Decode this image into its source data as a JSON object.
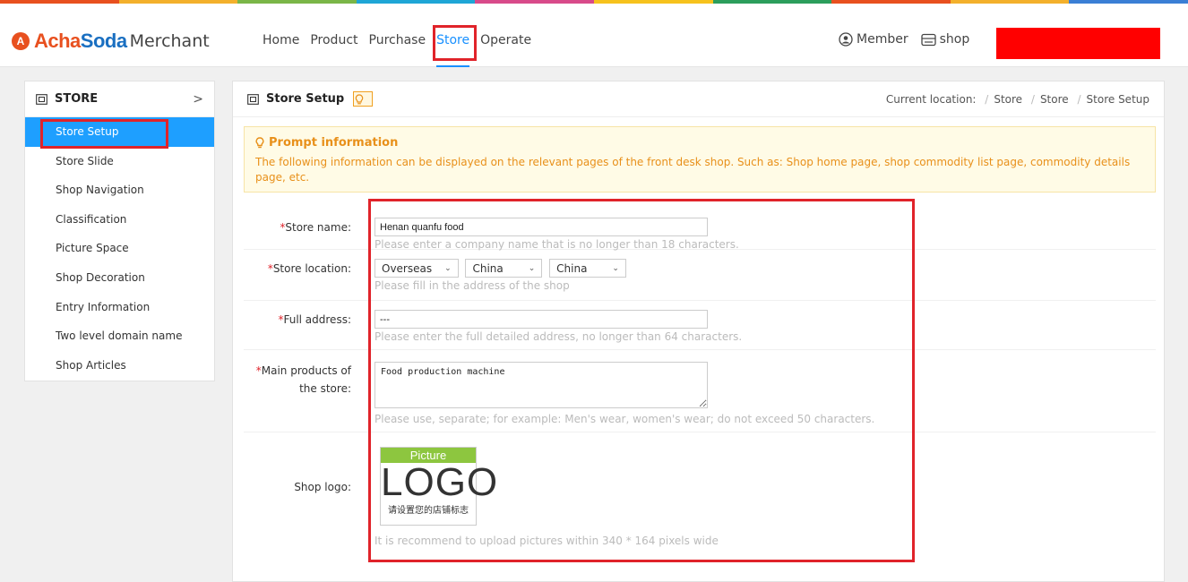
{
  "stripe_colors": [
    "#e8501f",
    "#f3b02c",
    "#7ab648",
    "#1ea6d6",
    "#d84a8a",
    "#f6c21d",
    "#2c9e5c",
    "#e8501f",
    "#f3b02c",
    "#3a7fd5"
  ],
  "header": {
    "brand_achasoda": "AchaSoda",
    "brand_suffix": "Merchant",
    "nav": [
      {
        "label": "Home"
      },
      {
        "label": "Product"
      },
      {
        "label": "Purchase"
      },
      {
        "label": "Store",
        "active": true
      },
      {
        "label": "Operate"
      }
    ],
    "member_label": "Member",
    "shop_label": "shop"
  },
  "sidebar": {
    "title": "STORE",
    "items": [
      {
        "label": "Store Setup",
        "active": true
      },
      {
        "label": "Store Slide"
      },
      {
        "label": "Shop Navigation"
      },
      {
        "label": "Classification"
      },
      {
        "label": "Picture Space"
      },
      {
        "label": "Shop Decoration"
      },
      {
        "label": "Entry Information"
      },
      {
        "label": "Two level domain name"
      },
      {
        "label": "Shop Articles"
      }
    ]
  },
  "main": {
    "title": "Store Setup",
    "breadcrumb": {
      "prefix": "Current location:",
      "items": [
        "Store",
        "Store",
        "Store Setup"
      ]
    },
    "prompt": {
      "title": "Prompt information",
      "text": "The following information can be displayed on the relevant pages of the front desk shop. Such as: Shop home page, shop commodity list page, commodity details page, etc."
    },
    "form": {
      "store_name": {
        "label": "Store name:",
        "value": "Henan quanfu food",
        "hint": "Please enter a company name that is no longer than 18 characters."
      },
      "store_location": {
        "label": "Store location:",
        "selects": [
          "Overseas",
          "China",
          "China"
        ],
        "hint": "Please fill in the address of the shop"
      },
      "full_address": {
        "label": "Full address:",
        "value": "---",
        "hint": "Please enter the full detailed address, no longer than 64 characters."
      },
      "main_products": {
        "label_line1": "Main products of",
        "label_line2": "the store:",
        "value": "Food production machine",
        "hint": "Please use, separate; for example: Men's wear, women's wear; do not exceed 50 characters."
      },
      "shop_logo": {
        "label": "Shop logo:",
        "logo_picture_text": "Picture",
        "logo_big_text": "LOGO",
        "logo_cn_text": "请设置您的店铺标志",
        "hint": "It is recommend to upload pictures within 340 * 164 pixels wide"
      }
    }
  }
}
